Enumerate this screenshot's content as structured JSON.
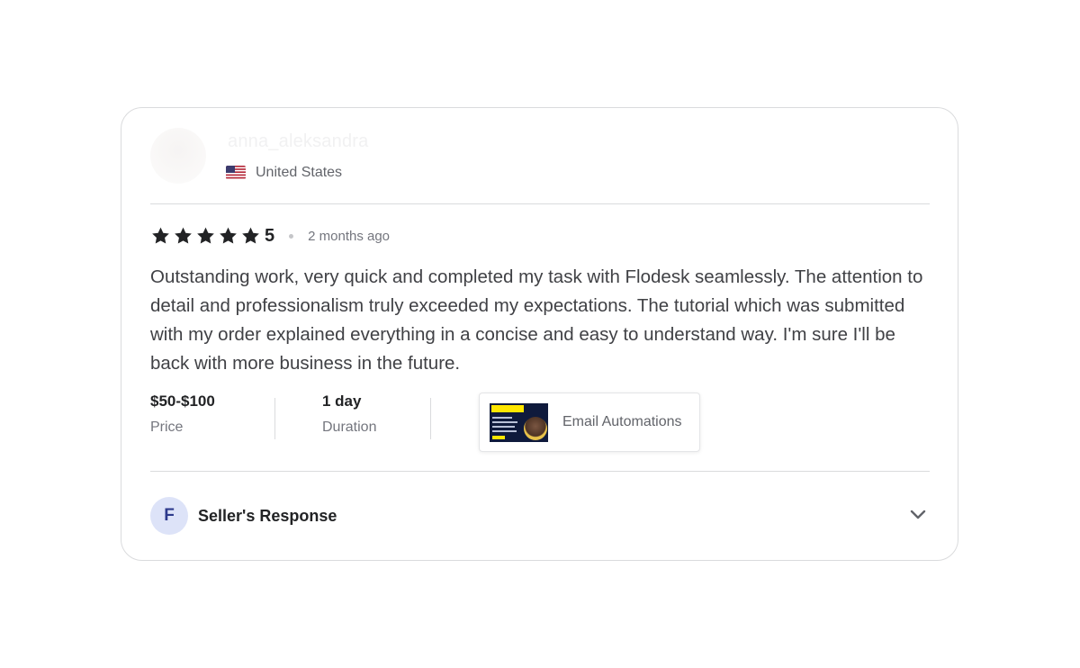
{
  "reviewer": {
    "username": "anna_aleksandra",
    "country": "United States",
    "flag_icon": "us-flag-icon"
  },
  "review": {
    "stars_filled": 5,
    "stars_total": 5,
    "rating": "5",
    "time_ago": "2 months ago",
    "text": "Outstanding work, very quick and completed my task with Flodesk seamlessly. The attention to detail and professionalism truly exceeded my expectations. The tutorial which was submitted with my order explained everything in a concise and easy to understand way. I'm sure I'll be back with more business in the future."
  },
  "meta": {
    "price_value": "$50-$100",
    "price_label": "Price",
    "duration_value": "1 day",
    "duration_label": "Duration"
  },
  "gig": {
    "thumbnail_heading": "Flodesk expert",
    "title": "Email Automations"
  },
  "seller_response": {
    "avatar_letter": "F",
    "label": "Seller's Response",
    "toggle_icon": "chevron-down-icon"
  },
  "colors": {
    "star": "#222325",
    "border": "#dadbdd",
    "avatar_bg": "#dde3f8",
    "accent_yellow": "#ffe600"
  }
}
